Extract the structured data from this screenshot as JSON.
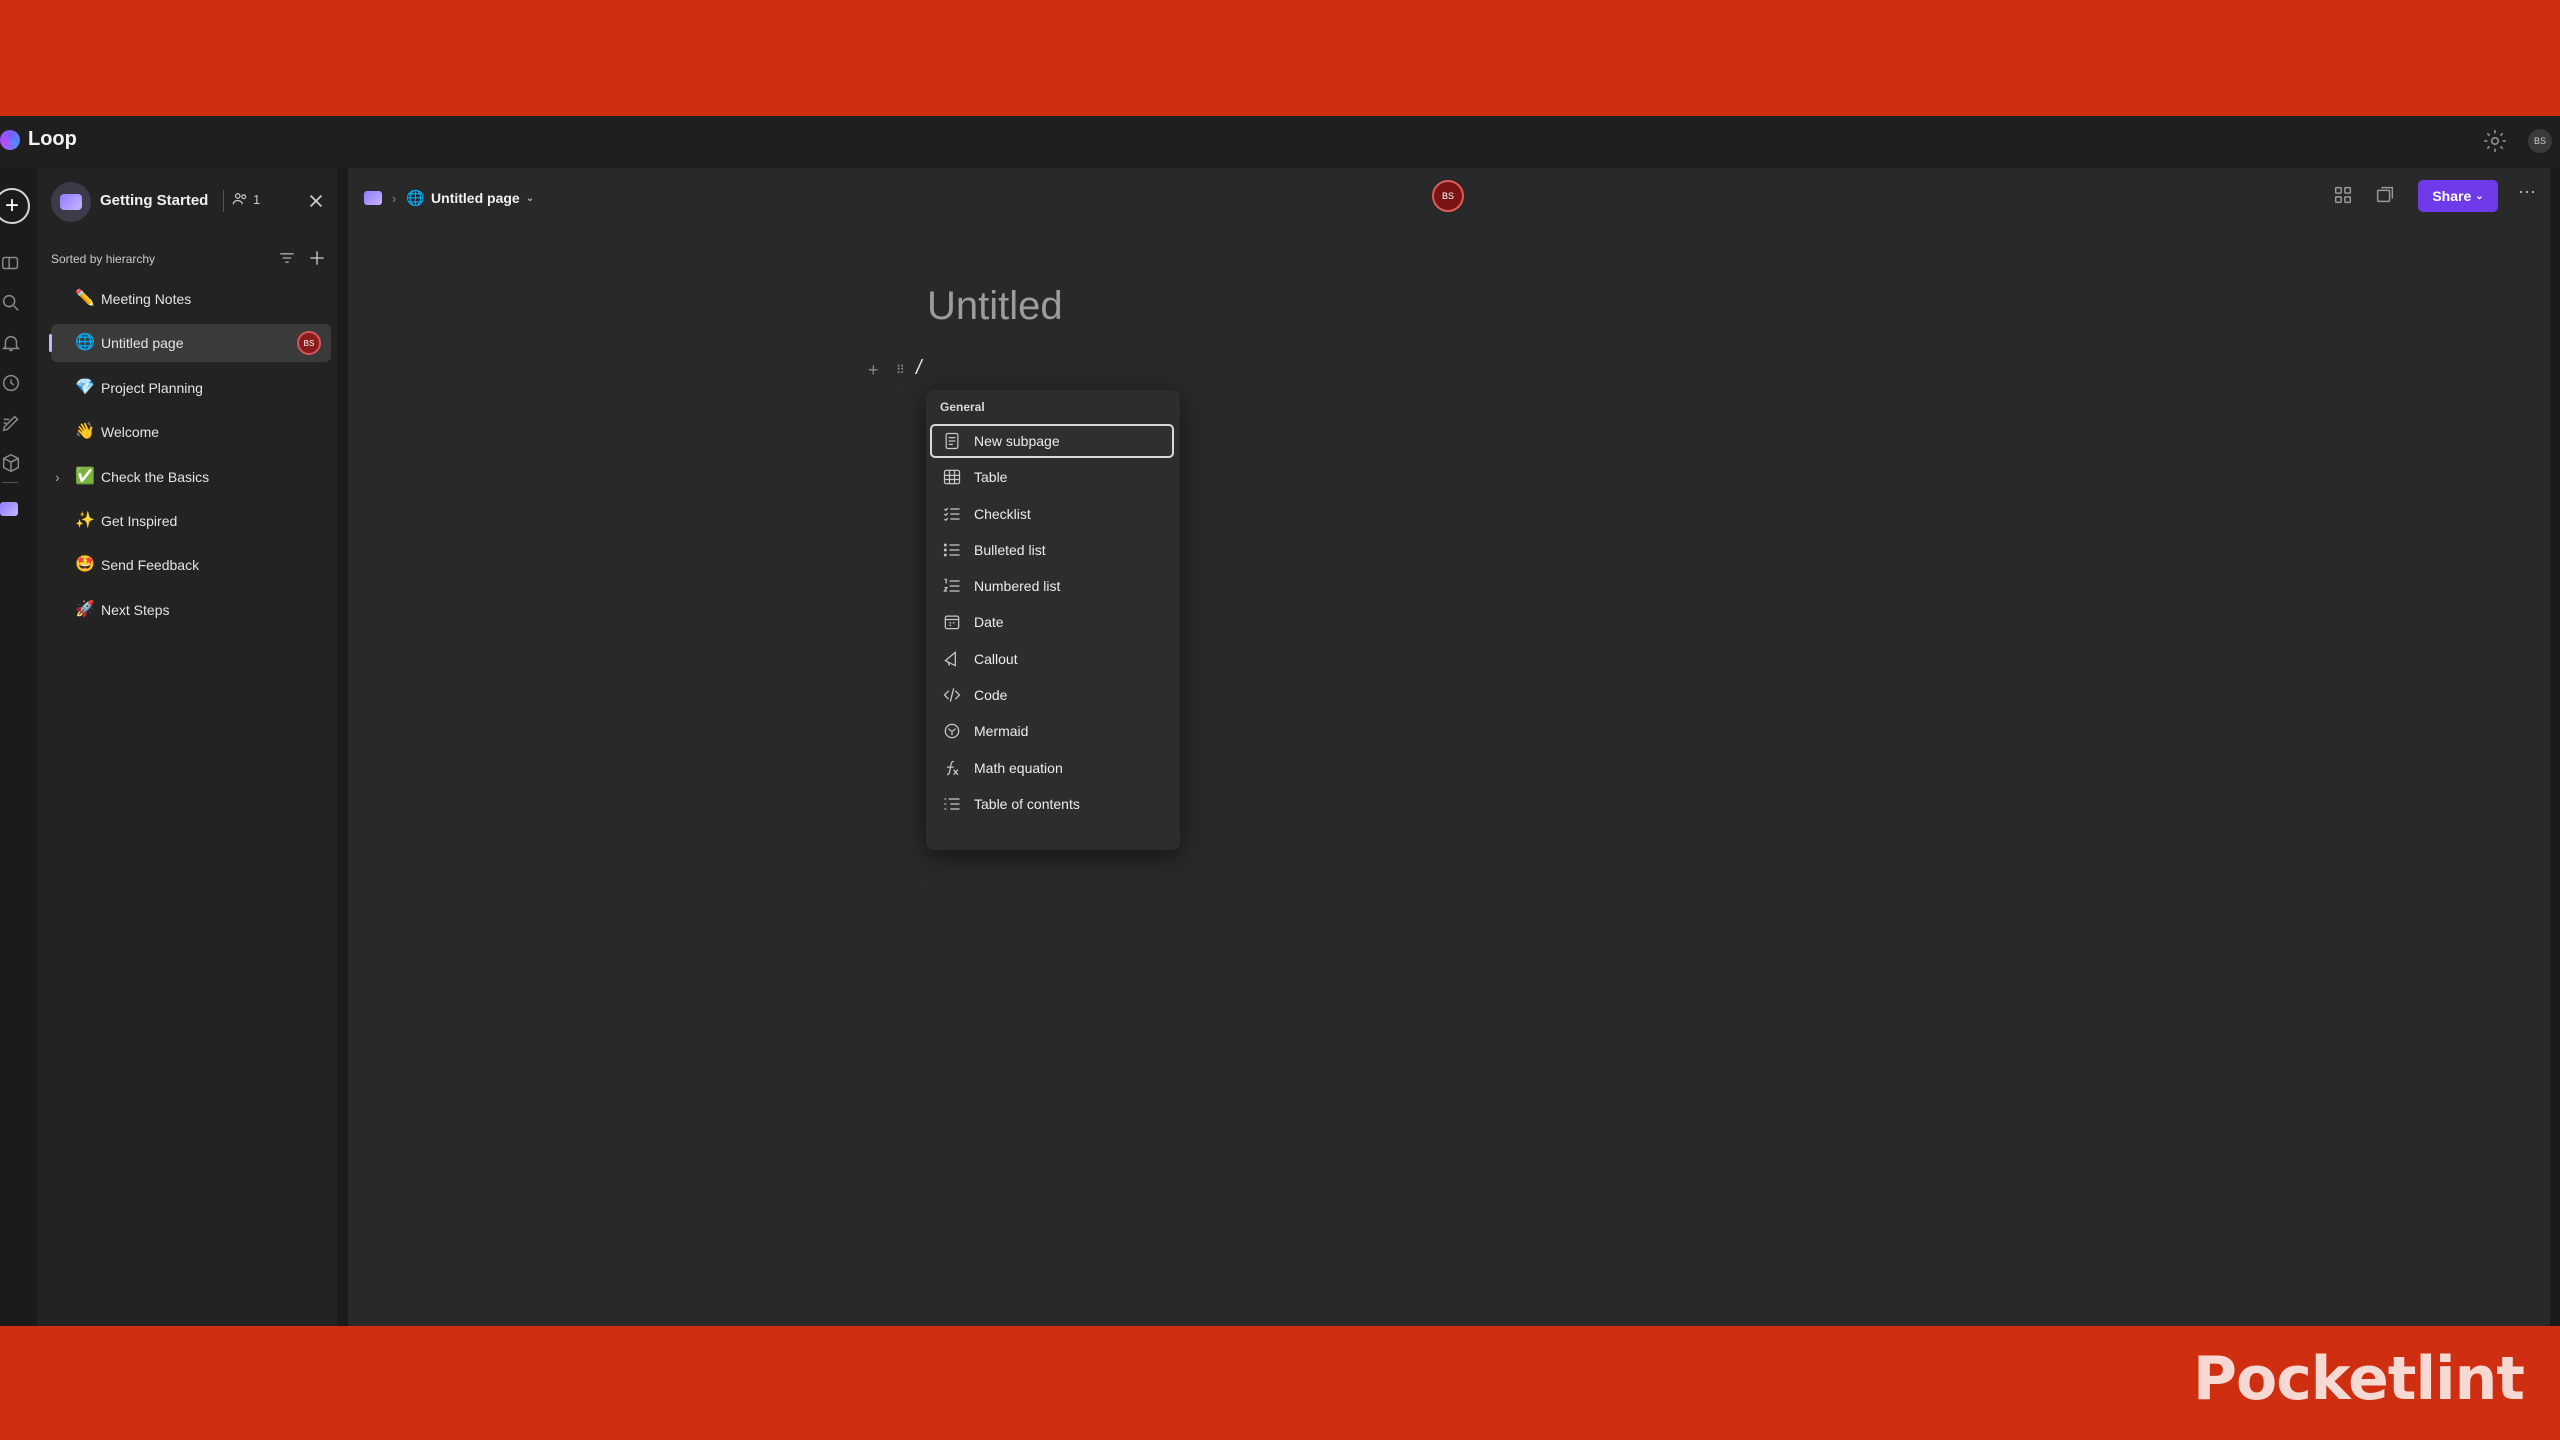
{
  "app": {
    "title": "Loop"
  },
  "titlebar": {
    "avatar_initials": "BS"
  },
  "workspace": {
    "name": "Getting Started",
    "member_count": "1"
  },
  "sidebar": {
    "sort_label": "Sorted by hierarchy",
    "items": [
      {
        "label": "Meeting Notes",
        "emoji": "✏️",
        "active": false
      },
      {
        "label": "Untitled page",
        "emoji": "🌐",
        "active": true,
        "badge": "BS"
      },
      {
        "label": "Project Planning",
        "emoji": "💎",
        "active": false
      },
      {
        "label": "Welcome",
        "emoji": "👋",
        "active": false
      },
      {
        "label": "Check the Basics",
        "emoji": "✅",
        "active": false,
        "expandable": true
      },
      {
        "label": "Get Inspired",
        "emoji": "✨",
        "active": false
      },
      {
        "label": "Send Feedback",
        "emoji": "🤩",
        "active": false
      },
      {
        "label": "Next Steps",
        "emoji": "🚀",
        "active": false
      }
    ]
  },
  "header": {
    "breadcrumb_page": "Untitled page",
    "presence_initials": "BS",
    "share_label": "Share"
  },
  "page": {
    "title_placeholder": "Untitled",
    "block_text": "/"
  },
  "slash_menu": {
    "section": "General",
    "items": [
      {
        "label": "New subpage",
        "icon": "page-icon",
        "selected": true
      },
      {
        "label": "Table",
        "icon": "table-icon"
      },
      {
        "label": "Checklist",
        "icon": "checklist-icon"
      },
      {
        "label": "Bulleted list",
        "icon": "bulleted-list-icon"
      },
      {
        "label": "Numbered list",
        "icon": "numbered-list-icon"
      },
      {
        "label": "Date",
        "icon": "calendar-icon"
      },
      {
        "label": "Callout",
        "icon": "megaphone-icon"
      },
      {
        "label": "Code",
        "icon": "code-icon"
      },
      {
        "label": "Mermaid",
        "icon": "mermaid-icon"
      },
      {
        "label": "Math equation",
        "icon": "function-icon"
      },
      {
        "label": "Table of contents",
        "icon": "toc-icon"
      }
    ]
  },
  "brand": {
    "text": "Pocketlint"
  },
  "colors": {
    "frame": "#cf2f10",
    "accent": "#6f3bea",
    "presence": "#e05a5a"
  }
}
